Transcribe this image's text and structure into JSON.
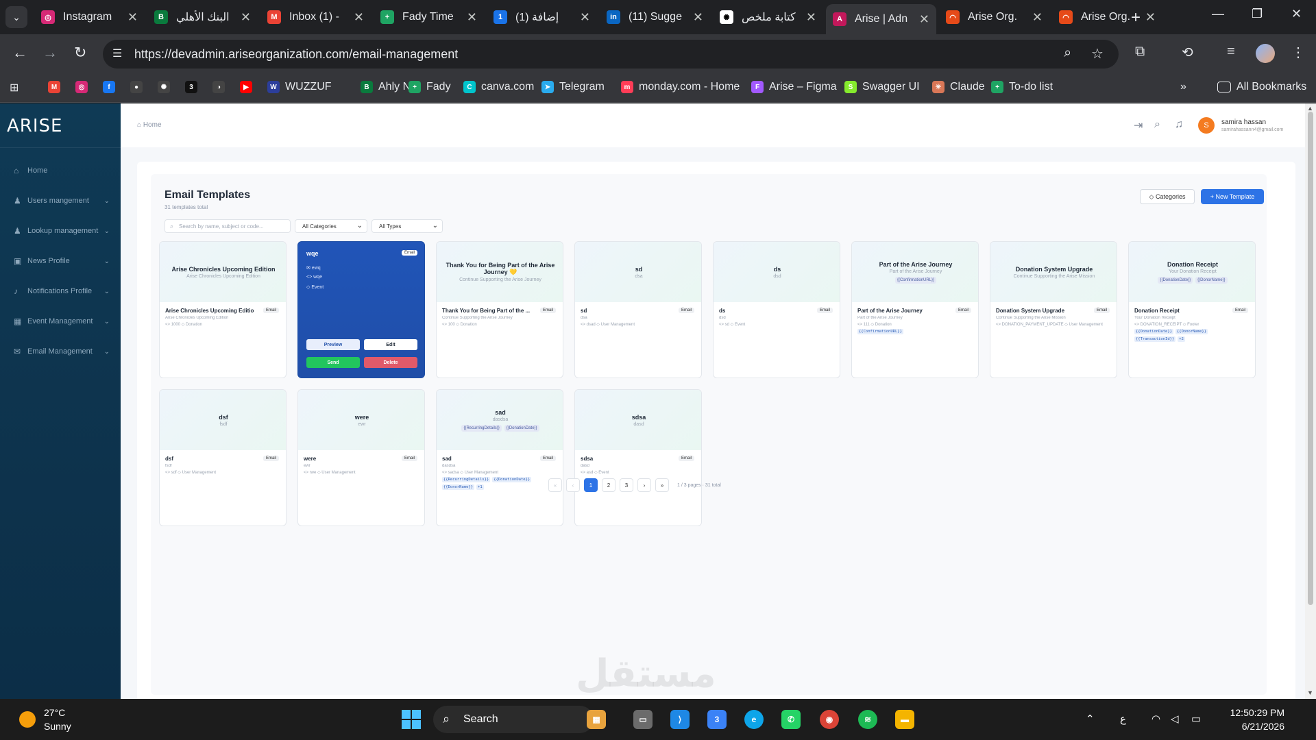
{
  "browser": {
    "tabs": [
      {
        "title": "Instagram",
        "color": "#d62976",
        "glyph": "◎"
      },
      {
        "title": "البنك الأهلي",
        "color": "#0a7a3d",
        "glyph": "B"
      },
      {
        "title": "Inbox (1) -",
        "color": "#ea4335",
        "glyph": "M"
      },
      {
        "title": "Fady Time",
        "color": "#1fa463",
        "glyph": "+"
      },
      {
        "title": "(1) إضافة",
        "color": "#1a73e8",
        "glyph": "1"
      },
      {
        "title": "(11) Sugge",
        "color": "#0a66c2",
        "glyph": "in"
      },
      {
        "title": "كتابة ملخص",
        "color": "#ffffff",
        "glyph": "✺"
      },
      {
        "title": "Arise | Adn",
        "color": "#c2185b",
        "glyph": "A"
      },
      {
        "title": "Arise Org.",
        "color": "#e64a19",
        "glyph": "◠"
      },
      {
        "title": "Arise Org.",
        "color": "#e64a19",
        "glyph": "◠"
      }
    ],
    "url": "https://devadmin.ariseorganization.com/email-management",
    "bookmarks": [
      {
        "label": "",
        "color": "#ea4335",
        "glyph": "M"
      },
      {
        "label": "",
        "color": "#d62976",
        "glyph": "◎"
      },
      {
        "label": "",
        "color": "#1877f2",
        "glyph": "f"
      },
      {
        "label": "",
        "color": "#444",
        "glyph": "●"
      },
      {
        "label": "",
        "color": "#444",
        "glyph": "✺"
      },
      {
        "label": "",
        "color": "#111",
        "glyph": "3"
      },
      {
        "label": "",
        "color": "#444",
        "glyph": "◑"
      },
      {
        "label": "",
        "color": "#ff0000",
        "glyph": "▶"
      },
      {
        "label": "WUZZUF",
        "color": "#2c3e9b",
        "glyph": "W"
      },
      {
        "label": "Ahly Net",
        "color": "#0a7a3d",
        "glyph": "B"
      },
      {
        "label": "Fady",
        "color": "#1fa463",
        "glyph": "+"
      },
      {
        "label": "canva.com",
        "color": "#00c4cc",
        "glyph": "C"
      },
      {
        "label": "Telegram",
        "color": "#2aabee",
        "glyph": "➤"
      },
      {
        "label": "monday.com - Home",
        "color": "#ff3d57",
        "glyph": "m"
      },
      {
        "label": "Arise – Figma",
        "color": "#a259ff",
        "glyph": "F"
      },
      {
        "label": "Swagger UI",
        "color": "#85ea2d",
        "glyph": "S"
      },
      {
        "label": "Claude",
        "color": "#d97757",
        "glyph": "✳"
      },
      {
        "label": "To-do list",
        "color": "#1fa463",
        "glyph": "+"
      }
    ],
    "all_bookmarks": "All Bookmarks"
  },
  "app": {
    "logo": "ARISE",
    "sidebar": [
      {
        "label": "Home",
        "icon": "home-icon",
        "glyph": "⌂",
        "chevron": false
      },
      {
        "label": "Users mangement",
        "icon": "users-icon",
        "glyph": "♟",
        "chevron": true
      },
      {
        "label": "Lookup management",
        "icon": "lookup-icon",
        "glyph": "♟",
        "chevron": true
      },
      {
        "label": "News Profile",
        "icon": "news-icon",
        "glyph": "▣",
        "chevron": true
      },
      {
        "label": "Notifications Profile",
        "icon": "bell-icon",
        "glyph": "♪",
        "chevron": true
      },
      {
        "label": "Event Management",
        "icon": "calendar-icon",
        "glyph": "▦",
        "chevron": true
      },
      {
        "label": "Email Management",
        "icon": "mail-icon",
        "glyph": "✉",
        "chevron": true
      }
    ],
    "breadcrumb": "Home",
    "user": {
      "initial": "S",
      "name": "samira hassan",
      "email": "samirahassann4@gmail.com"
    }
  },
  "templates": {
    "title": "Email Templates",
    "subtitle": "31 templates total",
    "categories_btn": "Categories",
    "new_btn": "+ New Template",
    "search_placeholder": "Search by name, subject or code...",
    "category_filter": "All Categories",
    "type_filter": "All Types",
    "cards": [
      {
        "head_title": "Arise Chronicles Upcoming Edition",
        "head_sub": "Arise Chronicles Upcoming Edition",
        "head_vars": [],
        "title": "Arise Chronicles Upcoming Edition",
        "badge": "Email",
        "sub": "Arise Chronicles Upcoming Edition",
        "meta": "<> 1000  ◇ Donation",
        "vars": []
      },
      {
        "hover": true,
        "title": "wqe",
        "badge": "Email",
        "lines": [
          "✉ ewq",
          "<> wqe",
          "◇ Event"
        ],
        "preview": "Preview",
        "edit": "Edit",
        "send": "Send",
        "delete": "Delete"
      },
      {
        "head_title": "Thank You for Being Part of the Arise Journey 💛",
        "head_sub": "Continue Supporting the Arise Journey",
        "head_vars": [],
        "title": "Thank You for Being Part of the ...",
        "badge": "Email",
        "sub": "Continue Supporting the Arise Journey",
        "meta": "<> 100  ◇ Donation",
        "vars": []
      },
      {
        "head_title": "sd",
        "head_sub": "dsa",
        "head_vars": [],
        "title": "sd",
        "badge": "Email",
        "sub": "dsa",
        "meta": "<> dsad  ◇ User Management",
        "vars": []
      },
      {
        "head_title": "ds",
        "head_sub": "dsd",
        "head_vars": [],
        "title": "ds",
        "badge": "Email",
        "sub": "dsd",
        "meta": "<> sd  ◇ Event",
        "vars": []
      },
      {
        "head_title": "Part of the Arise Journey",
        "head_sub": "Part of the Arise Journey",
        "head_vars": [
          "{{ConfirmationURL}}"
        ],
        "title": "Part of the Arise Journey",
        "badge": "Email",
        "sub": "Part of the Arise Journey",
        "meta": "<> 111  ◇ Donation",
        "vars": [
          "{{ConfirmationURL}}"
        ]
      },
      {
        "head_title": "Donation System Upgrade",
        "head_sub": "Continue Supporting the Arise Mission",
        "head_vars": [],
        "title": "Donation System Upgrade",
        "badge": "Email",
        "sub": "Continue Supporting the Arise Mission",
        "meta": "<> DONATION_PAYMENT_UPDATE  ◇ User Management",
        "vars": []
      },
      {
        "head_title": "Donation Receipt",
        "head_sub": "Your Donation Receipt",
        "head_vars": [
          "{{DonationDate}}",
          "{{DonorName}}"
        ],
        "title": "Donation Receipt",
        "badge": "Email",
        "sub": "Your Donation Receipt",
        "meta": "<> DONATION_RECEIPT  ◇ Footer",
        "vars": [
          "{{DonationDate}}",
          "{{DonorName}}",
          "{{TransactionId}}",
          "+2"
        ]
      },
      {
        "head_title": "dsf",
        "head_sub": "fsdf",
        "head_vars": [],
        "title": "dsf",
        "badge": "Email",
        "sub": "fsdf",
        "meta": "<> sdf  ◇ User Management",
        "vars": []
      },
      {
        "head_title": "were",
        "head_sub": "ewr",
        "head_vars": [],
        "title": "were",
        "badge": "Email",
        "sub": "ewr",
        "meta": "<> rwe  ◇ User Management",
        "vars": []
      },
      {
        "head_title": "sad",
        "head_sub": "dasdsa",
        "head_vars": [
          "{{RecurringDetails}}",
          "{{DonationDate}}"
        ],
        "title": "sad",
        "badge": "Email",
        "sub": "dasdsa",
        "meta": "<> sadsa  ◇ User Management",
        "vars": [
          "{{RecurringDetails}}",
          "{{DonationDate}}",
          "{{DonorName}}",
          "+1"
        ]
      },
      {
        "head_title": "sdsa",
        "head_sub": "dasd",
        "head_vars": [],
        "title": "sdsa",
        "badge": "Email",
        "sub": "dasd",
        "meta": "<> asd  ◇ Event",
        "vars": []
      }
    ],
    "pagination": {
      "pages": [
        "1",
        "2",
        "3"
      ],
      "current": "1",
      "info": "1 / 3 pages · 31 total"
    }
  },
  "watermark": "مستقل",
  "taskbar": {
    "temp": "27°C",
    "condition": "Sunny",
    "search": "Search",
    "lang": "ع",
    "time": "12:50:29 PM",
    "date": "6/21/2026"
  }
}
